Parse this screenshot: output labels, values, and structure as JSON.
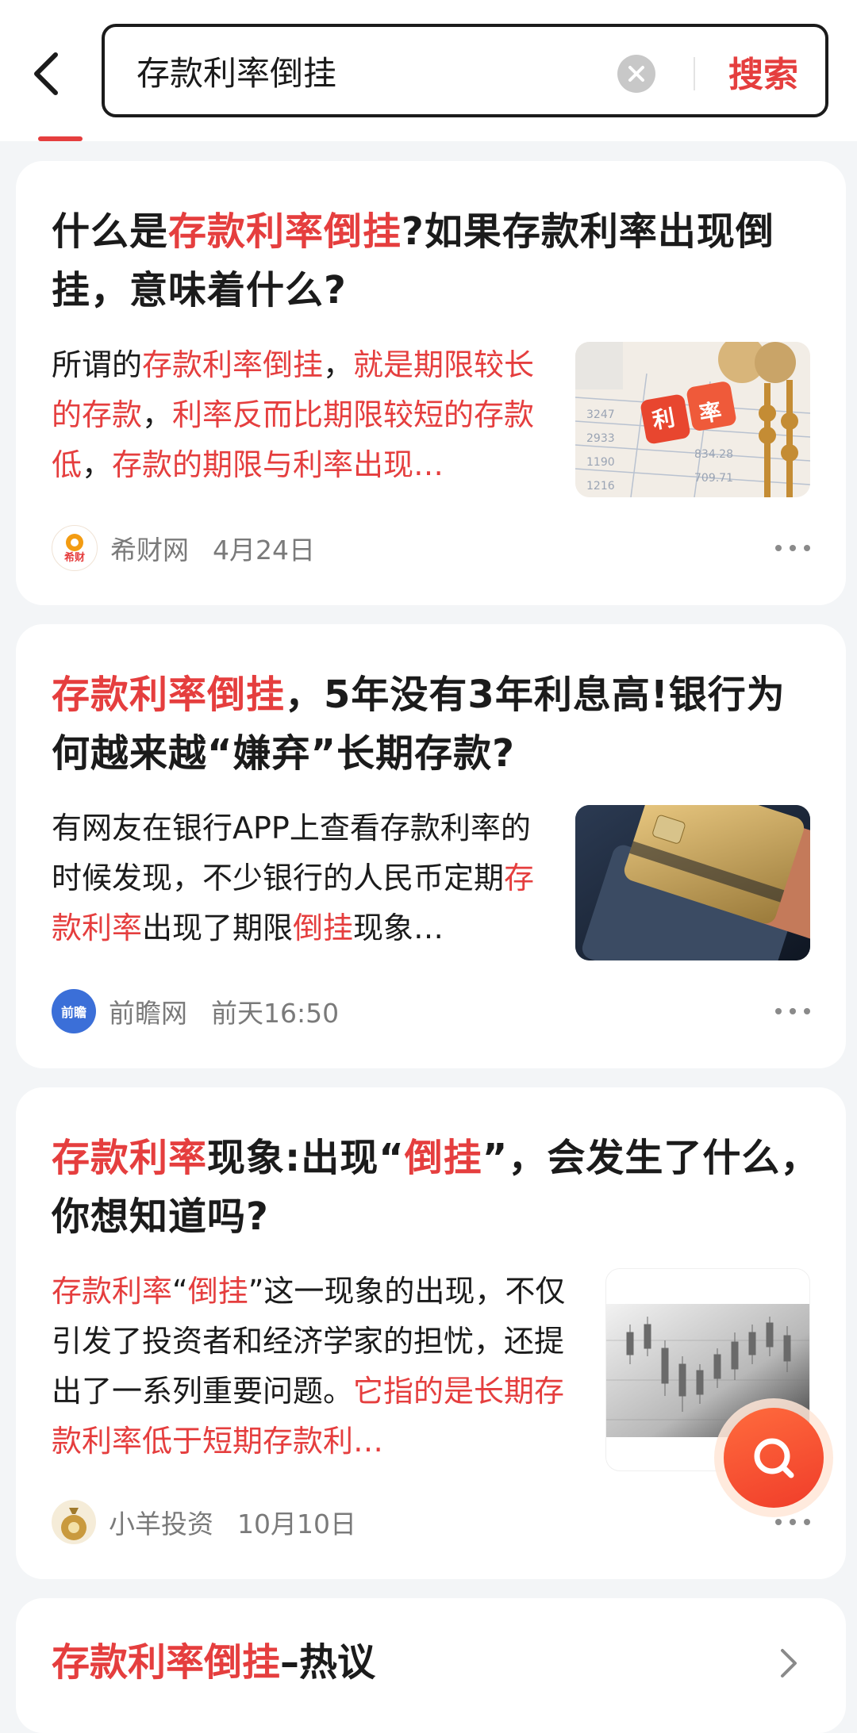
{
  "header": {
    "search_value": "存款利率倒挂",
    "search_button": "搜索"
  },
  "colors": {
    "accent": "#e53e3e",
    "text": "#1b1b1b",
    "meta": "#7a7a7a",
    "background": "#f3f5f7"
  },
  "results": [
    {
      "title_parts": [
        "什么是",
        "存款利率倒挂",
        "?如果存款利率出现倒挂，意味着什么?"
      ],
      "snippet_parts": [
        "所谓的",
        "存款利率倒挂",
        "，",
        "就是期限较长的存款",
        "，",
        "利率反而比期限较短的存款低",
        "，",
        "存款的期限与利率出现…"
      ],
      "thumbnail": {
        "label_chars": [
          "利",
          "率"
        ],
        "icon": "interest-rate-dice-image"
      },
      "source": "希财网",
      "source_logo_text": "希财",
      "time": "4月24日"
    },
    {
      "title_parts": [
        "存款利率倒挂",
        "，5年没有3年利息高!银行为何越来越“嫌弃”长期存款?"
      ],
      "snippet_parts": [
        "有网友在银行APP上查看存款利率的时候发现，不少银行的人民币定期",
        "存款利率",
        "出现了期限",
        "倒挂",
        "现象…"
      ],
      "thumbnail": {
        "icon": "bank-cards-image"
      },
      "source": "前瞻网",
      "source_logo_text": "前瞻",
      "time": "前天16:50"
    },
    {
      "title_parts": [
        "存款利率",
        "现象:出现“",
        "倒挂",
        "”，会发生了什么，你想知道吗?"
      ],
      "snippet_parts": [
        "存款利率",
        "“",
        "倒挂",
        "”这一现象的出现，不仅引发了投资者和经济学家的担忧，还提出了一系列重要问题。",
        "它指的是长期存款利率低于短期存款利…"
      ],
      "thumbnail": {
        "icon": "candlestick-chart-image"
      },
      "source": "小羊投资",
      "time": "10月10日"
    }
  ],
  "hot_section": {
    "title_highlight": "存款利率倒挂",
    "title_suffix": "–热议"
  }
}
